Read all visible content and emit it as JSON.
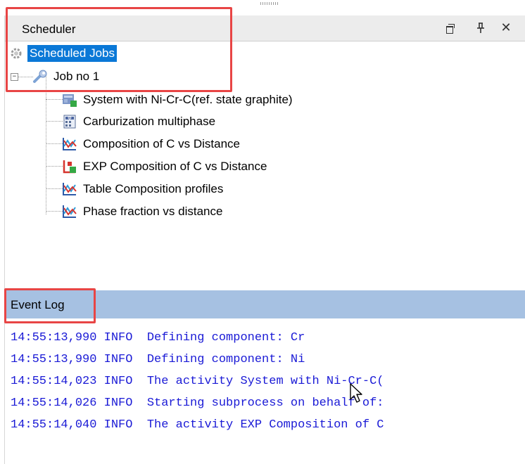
{
  "scheduler": {
    "title": "Scheduler",
    "controls": {
      "restore_icon": "restore-window-icon",
      "pin_glyph": "ᴘ",
      "close_glyph": "✕"
    },
    "root_label": "Scheduled Jobs",
    "job": {
      "label": "Job no 1",
      "expanded_glyph": "−",
      "activities": [
        {
          "label": "System with Ni-Cr-C(ref. state graphite)",
          "icon": "system-definer-icon"
        },
        {
          "label": "Carburization multiphase",
          "icon": "diffusion-calculator-icon"
        },
        {
          "label": "Composition of C vs Distance",
          "icon": "plot-renderer-icon"
        },
        {
          "label": "EXP Composition of C vs Distance",
          "icon": "experimental-file-icon"
        },
        {
          "label": "Table Composition profiles",
          "icon": "plot-renderer-icon"
        },
        {
          "label": "Phase fraction vs distance",
          "icon": "plot-renderer-icon"
        }
      ]
    }
  },
  "event_log": {
    "title": "Event Log",
    "lines": [
      "14:55:13,990 INFO  Defining component: Cr",
      "14:55:13,990 INFO  Defining component: Ni",
      "14:55:14,023 INFO  The activity System with Ni-Cr-C(",
      "14:55:14,026 INFO  Starting subprocess on behalf of:",
      "14:55:14,040 INFO  The activity EXP Composition of C"
    ]
  },
  "colors": {
    "selection": "#0a78d7",
    "log_header": "#a6c1e2",
    "log_text": "#1a1ad6",
    "highlight": "#e84545"
  }
}
